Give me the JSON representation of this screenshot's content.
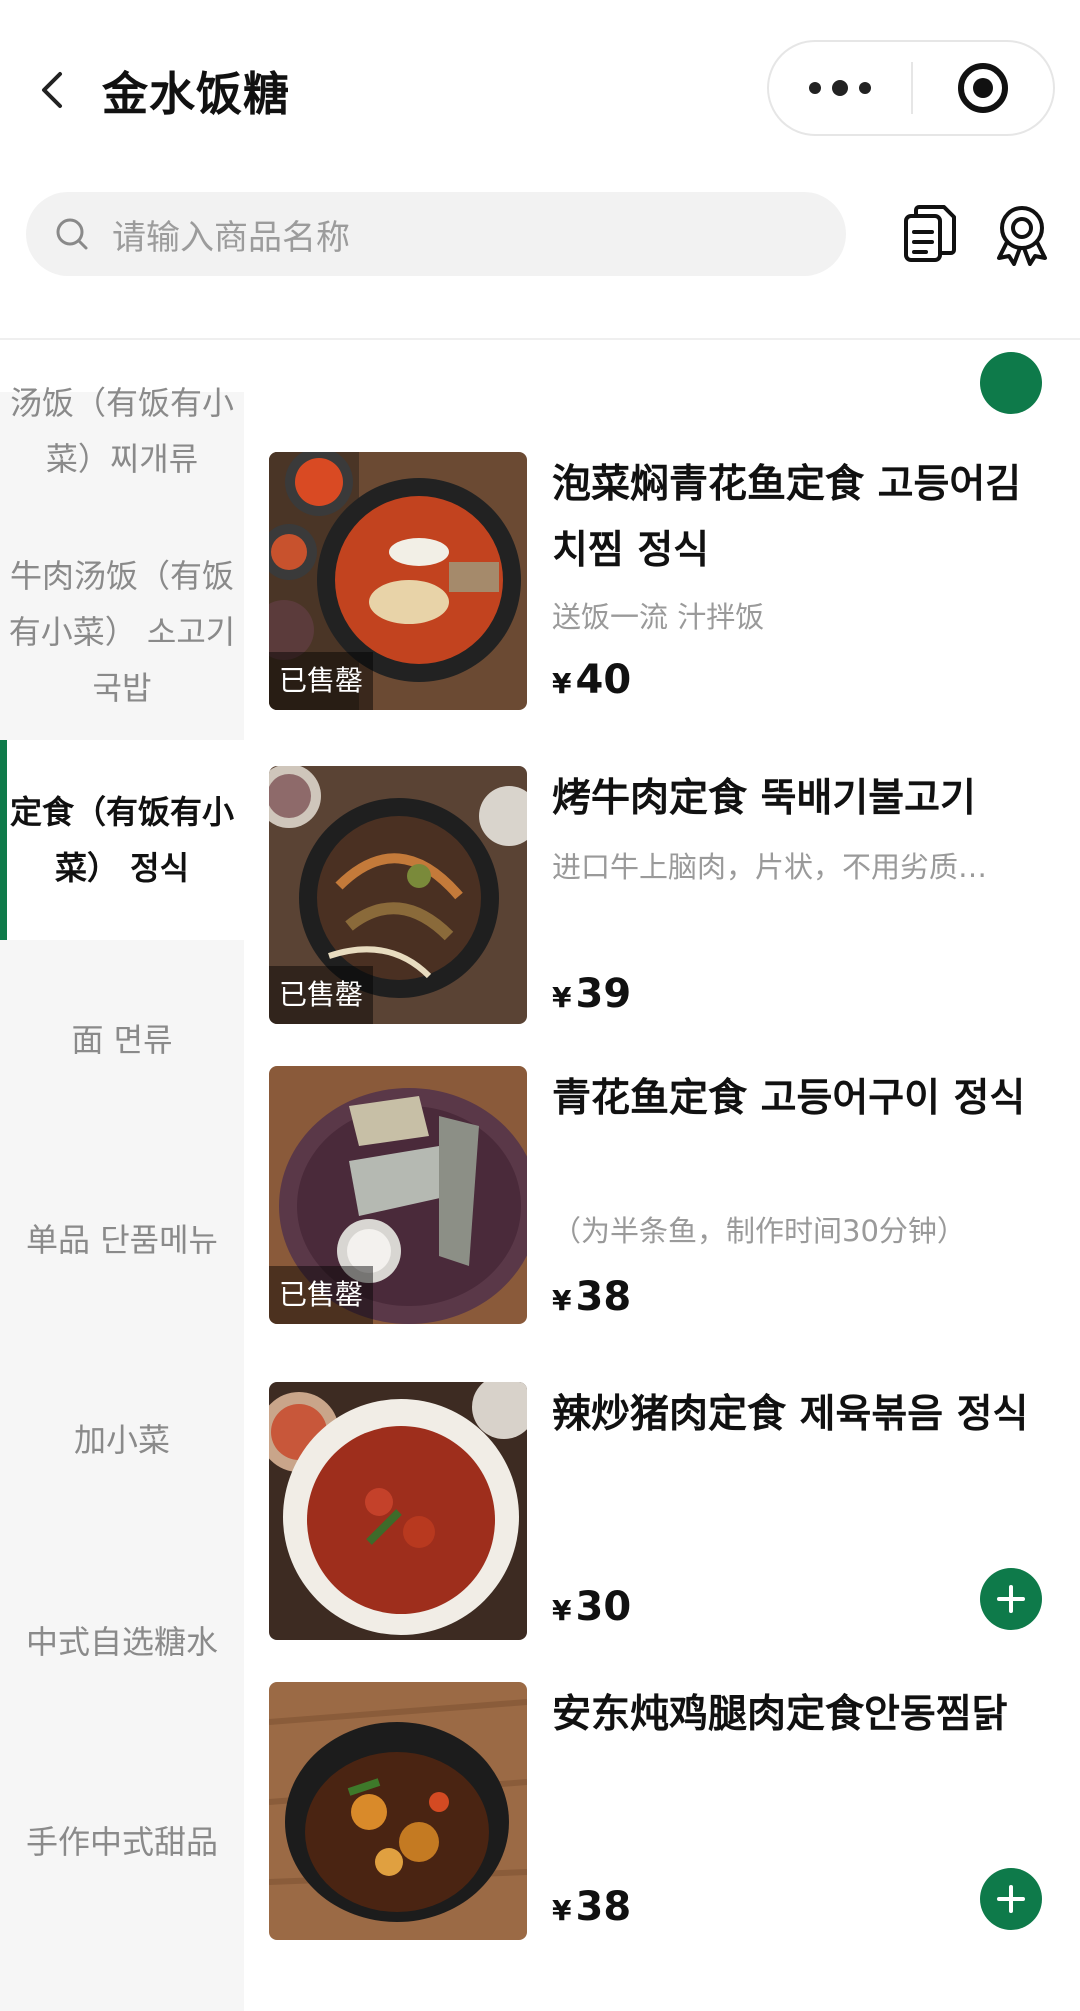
{
  "header": {
    "title": "金水饭糖",
    "back_icon": "chevron-left-icon",
    "more_icon": "more-dots-icon",
    "close_icon": "target-icon"
  },
  "search": {
    "placeholder": "请输入商品名称",
    "icon": "search-icon"
  },
  "toolbar": {
    "orders_icon": "document-icon",
    "member_icon": "award-badge-icon"
  },
  "sidebar": {
    "items": [
      {
        "label": "汤饭（有饭有小菜）찌개류"
      },
      {
        "label": "牛肉汤饭（有饭有小菜） 소고기국밥"
      },
      {
        "label": "定食（有饭有小菜） 정식",
        "active": true
      },
      {
        "label": "面 면류"
      },
      {
        "label": "单品 단품메뉴"
      },
      {
        "label": "加小菜"
      },
      {
        "label": "中式自选糖水"
      },
      {
        "label": "手作中式甜品"
      }
    ]
  },
  "products": [
    {
      "name": "泡菜焖青花鱼定食 고등어김치찜 정식",
      "desc": "送饭一流 汁拌饭",
      "currency": "¥",
      "price": "40",
      "status": "已售罄"
    },
    {
      "name": "烤牛肉定食 뚝배기불고기",
      "desc": "进口牛上脑肉，片状，不用劣质…",
      "currency": "¥",
      "price": "39",
      "status": "已售罄"
    },
    {
      "name": "青花鱼定食 고등어구이 정식",
      "desc": "（为半条鱼，制作时间30分钟）",
      "currency": "¥",
      "price": "38",
      "status": "已售罄"
    },
    {
      "name": "辣炒猪肉定食 제육볶음 정식",
      "desc": "",
      "currency": "¥",
      "price": "30",
      "status": ""
    },
    {
      "name": "安东炖鸡腿肉定食안동찜닭",
      "desc": "",
      "currency": "¥",
      "price": "38",
      "status": ""
    }
  ],
  "colors": {
    "accent": "#0e7a4a",
    "sidebar_bg": "#f6f6f6",
    "muted_text": "#9a9a9a"
  }
}
